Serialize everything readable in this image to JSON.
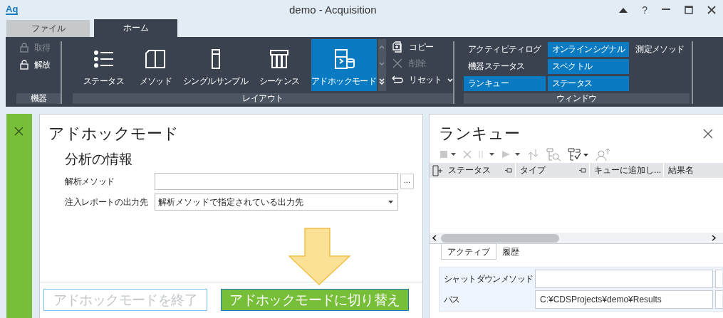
{
  "window": {
    "logo": "Aq",
    "title": "demo - Acquisition",
    "help": "?"
  },
  "ribbon_tabs": [
    {
      "label": "ファイル",
      "selected": false
    },
    {
      "label": "ホーム",
      "selected": true
    }
  ],
  "instrument_group": {
    "label": "機器",
    "items": [
      {
        "label": "取得",
        "disabled": true
      },
      {
        "label": "解放",
        "disabled": false
      }
    ]
  },
  "layout_group": {
    "label": "レイアウト",
    "buttons": [
      {
        "label": "ステータス",
        "selected": false
      },
      {
        "label": "メソッド",
        "selected": false
      },
      {
        "label": "シングルサンプル",
        "selected": false
      },
      {
        "label": "シーケンス",
        "selected": false
      },
      {
        "label": "アドホックモード",
        "selected": true
      }
    ],
    "edit_items": [
      {
        "label": "コピー",
        "disabled": false
      },
      {
        "label": "削除",
        "disabled": true
      },
      {
        "label": "リセット",
        "disabled": false
      }
    ]
  },
  "window_group": {
    "label": "ウィンドウ",
    "items": [
      {
        "label": "アクティビティログ",
        "selected": false
      },
      {
        "label": "機器ステータス",
        "selected": false
      },
      {
        "label": "ランキュー",
        "selected": true
      },
      {
        "label": "オンラインシグナル",
        "selected": true
      },
      {
        "label": "スペクトル",
        "selected": true
      },
      {
        "label": "ステータス",
        "selected": true
      },
      {
        "label": "測定メソッド",
        "selected": false
      }
    ]
  },
  "adhoc_panel": {
    "title": "アドホックモード",
    "section": "分析の情報",
    "fields": [
      {
        "kind": "browse",
        "label": "解析メソッド",
        "browse": "..."
      },
      {
        "kind": "dropdown",
        "label": "注入レポートの出力先",
        "value": "解析メソッドで指定されている出力先"
      }
    ],
    "buttons": [
      {
        "label": "アドホックモードを終了",
        "disabled": true
      },
      {
        "label": "アドホックモードに切り替え",
        "disabled": false
      }
    ]
  },
  "run_queue": {
    "title": "ランキュー",
    "columns": [
      "ステータス",
      "タイプ",
      "キューに追加し...",
      "結果名"
    ],
    "tabs": [
      {
        "label": "アクティブ",
        "selected": true
      },
      {
        "label": "履歴",
        "selected": false
      }
    ],
    "fields": [
      {
        "label": "シャットダウンメソッド"
      },
      {
        "label": "パス",
        "value": "C:¥CDSProjects¥demo¥Results"
      }
    ]
  }
}
